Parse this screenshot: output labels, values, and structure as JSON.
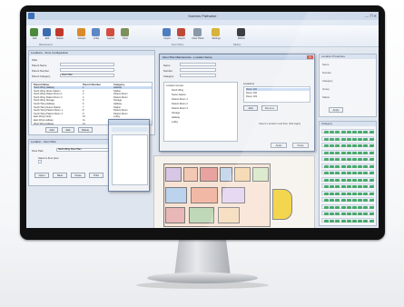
{
  "window": {
    "title": "Kaernis Pathwise"
  },
  "ribbon": {
    "tabs": [
      "File",
      "Home",
      "Dashboard",
      "Reports",
      "Setup",
      "Locations",
      "Maintenance"
    ],
    "active_tab": "Maintenance",
    "buttons": [
      "Add",
      "Edit",
      "Delete",
      "Groups",
      "Links",
      "Layout",
      "Find",
      "Import",
      "Export",
      "Floor Plans",
      "Settings",
      "Ribbon"
    ],
    "groups": [
      "Maintenance",
      "Floor Plans",
      "Ribbon"
    ]
  },
  "left_panel": {
    "title": "Locations - Zone Configuration",
    "labels": [
      "Filter",
      "Parent Name",
      "Parent Number",
      "Parent Category"
    ],
    "category_value": "Floor Plan",
    "columns": [
      "Parent Name",
      "Parent Number",
      "Category"
    ],
    "rows": [
      [
        "North Wing Hallway",
        "1",
        "Hallway"
      ],
      [
        "North Wing Nurse Station",
        "2",
        "Station"
      ],
      [
        "North Wing Patient Room 1",
        "3",
        "Patient Room"
      ],
      [
        "North Wing Patient Room 2",
        "4",
        "Patient Room"
      ],
      [
        "North Wing Storage",
        "5",
        "Storage"
      ],
      [
        "South Wing Hallway",
        "6",
        "Hallway"
      ],
      [
        "South Wing Nurse Station",
        "7",
        "Station"
      ],
      [
        "South Wing Patient Room 1",
        "8",
        "Patient Room"
      ],
      [
        "South Wing Patient Room 2",
        "9",
        "Patient Room"
      ],
      [
        "East Wing Lobby",
        "10",
        "Lobby"
      ],
      [
        "East Wing Hallway",
        "11",
        "Hallway"
      ],
      [
        "West Wing Hallway",
        "12",
        "Hallway"
      ]
    ],
    "buttons": [
      "Add",
      "Edit",
      "Delete"
    ]
  },
  "lower_panel": {
    "title": "Location - Floor Plan",
    "label": "Floor Plan",
    "value": "North Wing Floor Plan",
    "note": "Select a floor plan",
    "buttons": [
      "Open",
      "Save",
      "Close",
      "Print"
    ]
  },
  "dialog": {
    "title": "Floor Plan Maintenance - Location Setup",
    "labels": [
      "Name",
      "Number",
      "Category"
    ],
    "tree": [
      "Location Groups",
      "North Wing",
      "Nurse Station",
      "Patient Room 1",
      "Patient Room 2",
      "Patient Room 3",
      "Storage",
      "Hallway",
      "Lobby"
    ],
    "right_list_title": "Locations",
    "right_list": [
      "Room 101",
      "Room 102",
      "Room 103"
    ],
    "buttons": [
      "Add",
      "Remove",
      "Apply",
      "Close"
    ],
    "hint": "Select a location and then click Apply"
  },
  "right_panel": {
    "title": "Location Properties",
    "header": "Category",
    "button": "Apply",
    "fields": [
      "Name",
      "Number",
      "Category",
      "Group",
      "Status"
    ]
  }
}
